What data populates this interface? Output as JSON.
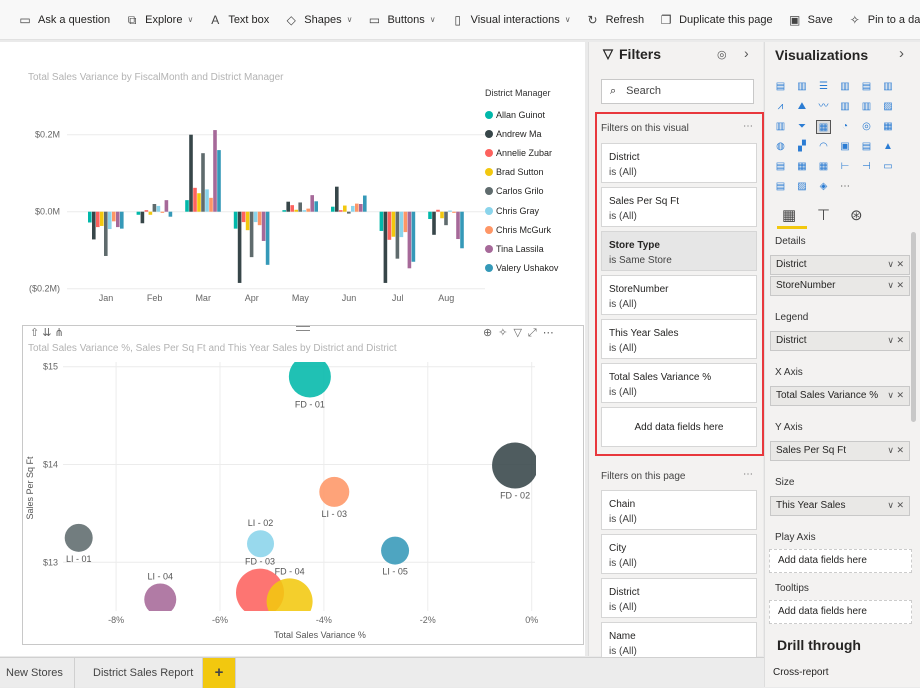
{
  "toolbar": [
    {
      "label": "Ask a question",
      "icon": "chat-icon",
      "dropdown": false
    },
    {
      "label": "Explore",
      "icon": "explore-icon",
      "dropdown": true
    },
    {
      "label": "Text box",
      "icon": "textbox-icon",
      "dropdown": false
    },
    {
      "label": "Shapes",
      "icon": "shapes-icon",
      "dropdown": true
    },
    {
      "label": "Buttons",
      "icon": "buttons-icon",
      "dropdown": true
    },
    {
      "label": "Visual interactions",
      "icon": "visual-interactions-icon",
      "dropdown": true
    },
    {
      "label": "Refresh",
      "icon": "refresh-icon",
      "dropdown": false
    },
    {
      "label": "Duplicate this page",
      "icon": "duplicate-icon",
      "dropdown": false
    },
    {
      "label": "Save",
      "icon": "save-icon",
      "dropdown": false
    },
    {
      "label": "Pin to a dashbo",
      "icon": "pin-icon",
      "dropdown": false
    }
  ],
  "chart_data": [
    {
      "type": "bar",
      "title": "Total Sales Variance by FiscalMonth and District Manager",
      "categories": [
        "Jan",
        "Feb",
        "Mar",
        "Apr",
        "May",
        "Jun",
        "Jul",
        "Aug"
      ],
      "ytick_labels": [
        "$0.2M",
        "$0.0M",
        "($0.2M)"
      ],
      "yticks": [
        0.2,
        0,
        -0.2
      ],
      "ylim": [
        -0.2,
        0.2
      ],
      "unit": "$M",
      "legend_title": "District Manager",
      "legend_position": "right",
      "grid": true,
      "series": [
        {
          "name": "Allan Guinot",
          "color": "#01b8aa",
          "values": [
            -0.028,
            -0.008,
            0.03,
            -0.044,
            0.004,
            0.013,
            -0.05,
            -0.019
          ]
        },
        {
          "name": "Andrew Ma",
          "color": "#374649",
          "values": [
            -0.072,
            -0.03,
            0.2,
            -0.185,
            0.026,
            0.065,
            -0.185,
            -0.06
          ]
        },
        {
          "name": "Annelie Zubar",
          "color": "#fd625e",
          "values": [
            -0.04,
            0.004,
            0.062,
            -0.027,
            0.017,
            0.004,
            -0.073,
            0.005
          ]
        },
        {
          "name": "Brad Sutton",
          "color": "#f2c80f",
          "values": [
            -0.037,
            -0.008,
            0.048,
            -0.048,
            0.005,
            0.016,
            -0.065,
            -0.017
          ]
        },
        {
          "name": "Carlos Grilo",
          "color": "#5f6b6d",
          "values": [
            -0.115,
            0.02,
            0.152,
            -0.118,
            0.024,
            -0.005,
            -0.122,
            -0.035
          ]
        },
        {
          "name": "Chris Gray",
          "color": "#8ad4eb",
          "values": [
            -0.045,
            0.015,
            0.058,
            -0.027,
            0.004,
            0.015,
            -0.066,
            0.003
          ]
        },
        {
          "name": "Chris McGurk",
          "color": "#fe9666",
          "values": [
            -0.025,
            -0.003,
            0.036,
            -0.035,
            0.008,
            0.021,
            -0.053,
            -0.003
          ]
        },
        {
          "name": "Tina Lassila",
          "color": "#a66999",
          "values": [
            -0.04,
            0.03,
            0.212,
            -0.076,
            0.043,
            0.02,
            -0.147,
            -0.071
          ]
        },
        {
          "name": "Valery Ushakov",
          "color": "#3599b8",
          "values": [
            -0.044,
            -0.013,
            0.16,
            -0.138,
            0.027,
            0.042,
            -0.13,
            -0.095
          ]
        }
      ]
    },
    {
      "type": "scatter",
      "title": "Total Sales Variance %, Sales Per Sq Ft and This Year Sales by District and District",
      "xlabel": "Total Sales Variance %",
      "ylabel": "Sales Per Sq Ft",
      "xticks": [
        -8,
        -6,
        -4,
        -2,
        0
      ],
      "xtick_labels": [
        "-8%",
        "-6%",
        "-4%",
        "-2%",
        "0%"
      ],
      "yticks": [
        13,
        14,
        15
      ],
      "ytick_labels": [
        "$13",
        "$14",
        "$15"
      ],
      "grid": true,
      "points": [
        {
          "label": "FD - 01",
          "x": -4.27,
          "y": 14.9,
          "size": 21,
          "color": "#01b8aa",
          "label_pos": "below"
        },
        {
          "label": "FD - 02",
          "x": -0.32,
          "y": 13.99,
          "size": 23,
          "color": "#374649",
          "label_pos": "below"
        },
        {
          "label": "LI - 03",
          "x": -3.8,
          "y": 13.72,
          "size": 15,
          "color": "#fe9666",
          "label_pos": "below"
        },
        {
          "label": "LI - 01",
          "x": -8.72,
          "y": 13.25,
          "size": 14,
          "color": "#5f6b6d",
          "label_pos": "below"
        },
        {
          "label": "LI - 02",
          "x": -5.22,
          "y": 13.19,
          "size": 13.5,
          "color": "#8ad4eb",
          "label_pos": "above"
        },
        {
          "label": "LI - 05",
          "x": -2.63,
          "y": 13.12,
          "size": 14,
          "color": "#3599b8",
          "label_pos": "below"
        },
        {
          "label": "LI - 04",
          "x": -7.15,
          "y": 12.62,
          "size": 16,
          "color": "#a66999",
          "label_pos": "above"
        },
        {
          "label": "FD - 03",
          "x": -5.23,
          "y": 12.69,
          "size": 24,
          "color": "#fd625e",
          "label_pos": "above"
        },
        {
          "label": "FD - 04",
          "x": -4.66,
          "y": 12.6,
          "size": 23,
          "color": "#f2c80f",
          "label_pos": "above"
        }
      ]
    }
  ],
  "filters": {
    "title": "Filters",
    "search_placeholder": "Search",
    "visual_section": "Filters on this visual",
    "visual_filters": [
      {
        "name": "District",
        "value": "is (All)"
      },
      {
        "name": "Sales Per Sq Ft",
        "value": "is (All)"
      },
      {
        "name": "Store Type",
        "value": "is Same Store",
        "active": true
      },
      {
        "name": "StoreNumber",
        "value": "is (All)"
      },
      {
        "name": "This Year Sales",
        "value": "is (All)"
      },
      {
        "name": "Total Sales Variance %",
        "value": "is (All)"
      }
    ],
    "add_fields": "Add data fields here",
    "page_section": "Filters on this page",
    "page_filters": [
      {
        "name": "Chain",
        "value": "is (All)"
      },
      {
        "name": "City",
        "value": "is (All)"
      },
      {
        "name": "District",
        "value": "is (All)"
      },
      {
        "name": "Name",
        "value": "is (All)"
      }
    ],
    "highlight_color": "#e8383d"
  },
  "viz": {
    "title": "Visualizations",
    "more": "...",
    "wells": [
      {
        "label": "Details",
        "fields": [
          "District",
          "StoreNumber"
        ]
      },
      {
        "label": "Legend",
        "fields": [
          "District"
        ]
      },
      {
        "label": "X Axis",
        "fields": [
          "Total Sales Variance %"
        ]
      },
      {
        "label": "Y Axis",
        "fields": [
          "Sales Per Sq Ft"
        ]
      },
      {
        "label": "Size",
        "fields": [
          "This Year Sales"
        ]
      },
      {
        "label": "Play Axis",
        "placeholder": "Add data fields here"
      },
      {
        "label": "Tooltips",
        "placeholder": "Add data fields here"
      }
    ],
    "drill_title": "Drill through",
    "cross_report": "Cross-report",
    "accent": "#f2c80f"
  },
  "tabs": [
    {
      "label": "New Stores"
    },
    {
      "label": "District Sales Report"
    }
  ],
  "add_tab": "+"
}
